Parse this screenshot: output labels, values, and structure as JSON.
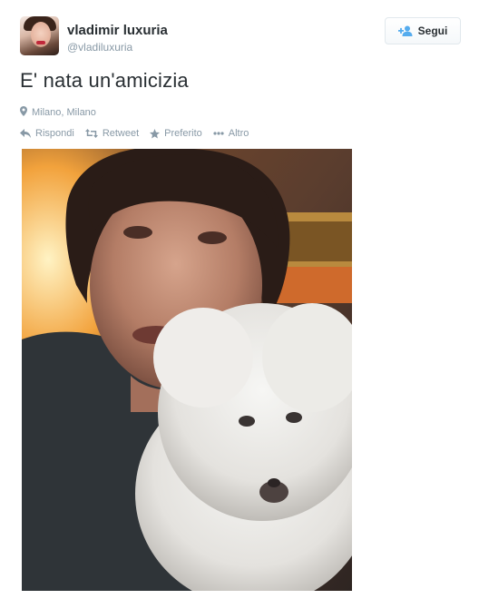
{
  "user": {
    "display_name": "vladimir luxuria",
    "screen_name": "@vladiluxuria"
  },
  "follow_button": {
    "label": "Segui",
    "icon": "add-user-icon"
  },
  "tweet": {
    "text": "E' nata un'amicizia",
    "location": "Milano, Milano",
    "location_icon": "location-pin-icon"
  },
  "actions": [
    {
      "label": "Rispondi",
      "icon": "reply-icon"
    },
    {
      "label": "Retweet",
      "icon": "retweet-icon"
    },
    {
      "label": "Preferito",
      "icon": "star-icon"
    },
    {
      "label": "Altro",
      "icon": "more-icon"
    }
  ],
  "photo": {
    "description_icon": "tweet-photo"
  },
  "colors": {
    "text": "#292f33",
    "muted": "#8899a6",
    "button_icon": "#55acee",
    "border": "#e1e8ed"
  }
}
